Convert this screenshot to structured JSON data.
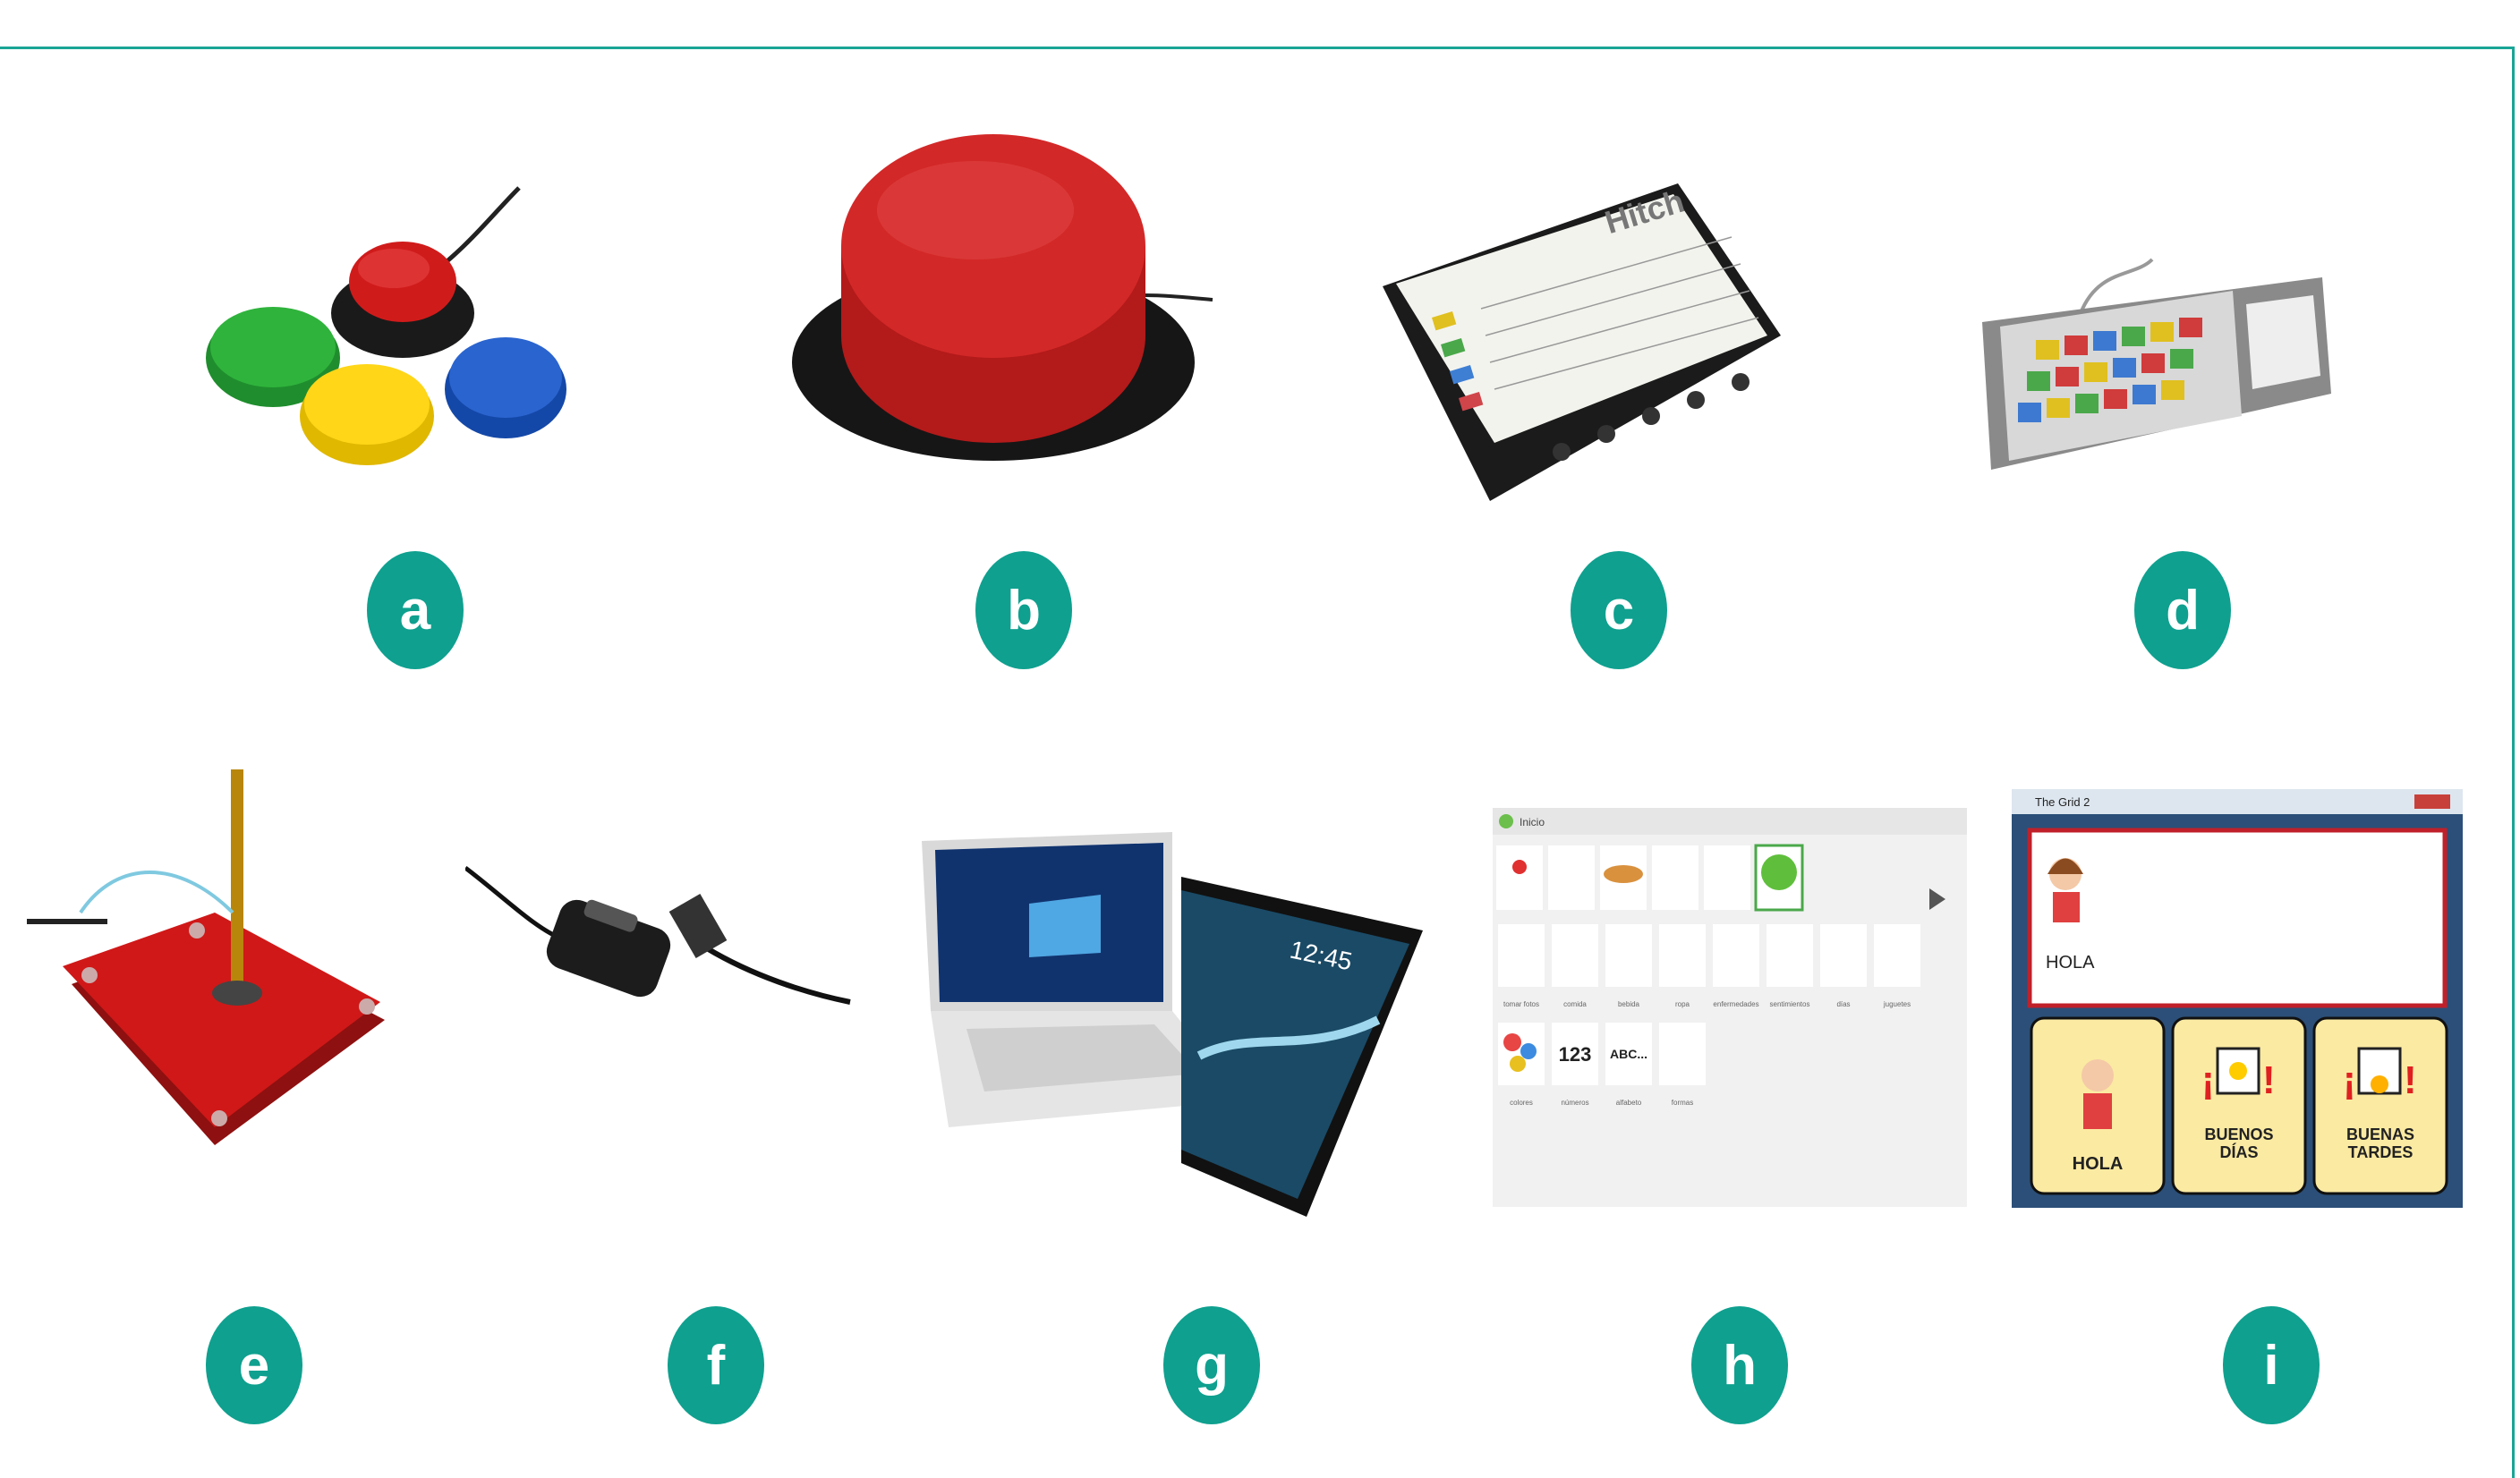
{
  "labels": [
    "a",
    "b",
    "c",
    "d",
    "e",
    "f",
    "g",
    "h",
    "i"
  ],
  "colors": {
    "accent": "#0fa08f",
    "border": "#19a596"
  },
  "hitch": {
    "brand": "Hitch"
  },
  "tablet": {
    "clock": "12:45"
  },
  "h": {
    "title": "Inicio",
    "numbers": "123",
    "letters": "ABC...",
    "cells": [
      "tomar fotos",
      "comida",
      "bebida",
      "ropa",
      "enfermedades",
      "sentimientos",
      "días",
      "juguetes",
      "colores",
      "números",
      "alfabeto",
      "formas"
    ]
  },
  "i": {
    "title": "The Grid 2",
    "message": "HOLA",
    "buttons": [
      "HOLA",
      "BUENOS\nDÍAS",
      "BUENAS\nTARDES"
    ]
  }
}
